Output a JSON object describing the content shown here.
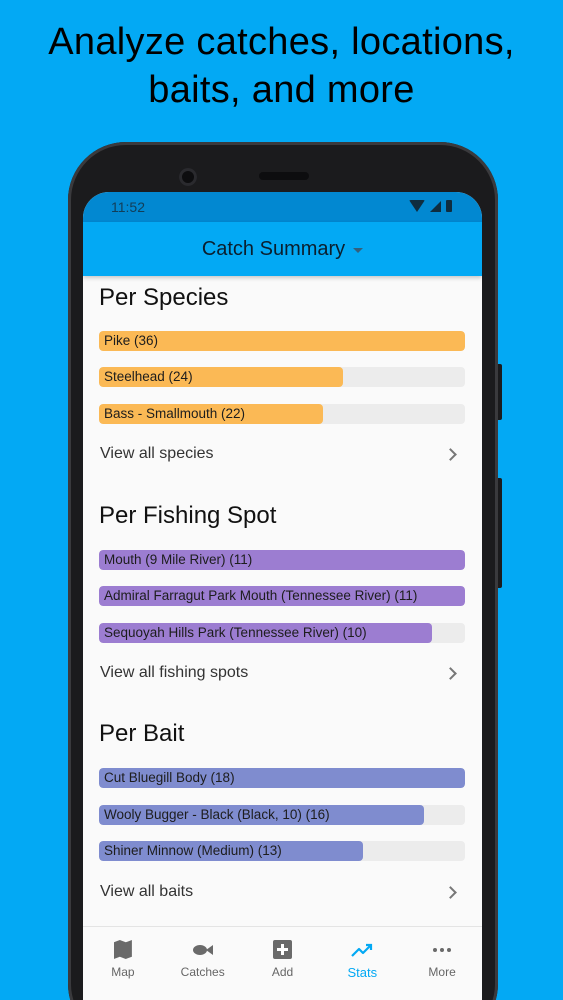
{
  "headline": "Analyze catches, locations, baits, and more",
  "status_bar": {
    "time": "11:52"
  },
  "app_bar": {
    "title": "Catch Summary"
  },
  "colors": {
    "species": "#fbb955",
    "spots": "#9c7dd1",
    "baits": "#7f8ccf",
    "accent": "#03a9f4"
  },
  "sections": [
    {
      "title": "Per Species",
      "view_all": "View all species",
      "bars": [
        {
          "label": "Pike (36)",
          "value": 36
        },
        {
          "label": "Steelhead (24)",
          "value": 24
        },
        {
          "label": "Bass - Smallmouth (22)",
          "value": 22
        }
      ]
    },
    {
      "title": "Per Fishing Spot",
      "view_all": "View all fishing spots",
      "bars": [
        {
          "label": "Mouth (9 Mile River) (11)",
          "value": 11
        },
        {
          "label": "Admiral Farragut Park Mouth (Tennessee River) (11)",
          "value": 11
        },
        {
          "label": "Sequoyah Hills Park (Tennessee River) (10)",
          "value": 10
        }
      ]
    },
    {
      "title": "Per Bait",
      "view_all": "View all baits",
      "bars": [
        {
          "label": "Cut Bluegill Body (18)",
          "value": 18
        },
        {
          "label": "Wooly Bugger - Black (Black, 10) (16)",
          "value": 16
        },
        {
          "label": "Shiner Minnow (Medium) (13)",
          "value": 13
        }
      ]
    }
  ],
  "bottom_nav": [
    {
      "label": "Map",
      "icon": "map-icon"
    },
    {
      "label": "Catches",
      "icon": "fish-icon"
    },
    {
      "label": "Add",
      "icon": "add-box-icon"
    },
    {
      "label": "Stats",
      "icon": "trending-up-icon",
      "active": true
    },
    {
      "label": "More",
      "icon": "more-horiz-icon"
    }
  ]
}
